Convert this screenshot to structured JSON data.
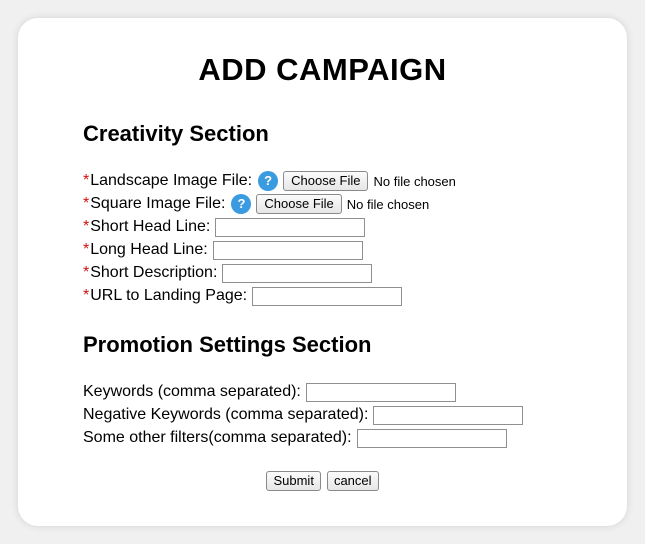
{
  "title": "ADD CAMPAIGN",
  "creativity": {
    "heading": "Creativity Section",
    "landscape_label": "Landscape Image File:",
    "square_label": "Square Image File:",
    "short_headline_label": "Short Head Line:",
    "long_headline_label": "Long Head Line:",
    "short_description_label": "Short Description:",
    "url_label": "URL to Landing Page:",
    "required_mark": "*",
    "help_glyph": "?",
    "choose_file_label": "Choose File",
    "no_file_text": "No file chosen"
  },
  "promotion": {
    "heading": "Promotion Settings Section",
    "keywords_label": "Keywords (comma separated):",
    "negative_keywords_label": "Negative Keywords (comma separated):",
    "other_filters_label": "Some other filters(comma separated):"
  },
  "actions": {
    "submit_label": "Submit",
    "cancel_label": "cancel"
  },
  "colors": {
    "required": "#d11111",
    "help_icon": "#3b9be0"
  }
}
